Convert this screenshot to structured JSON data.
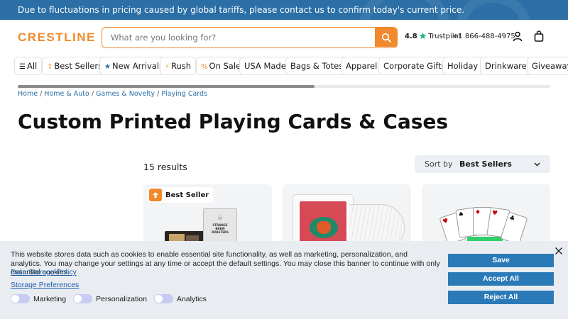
{
  "banner": {
    "text": "Due to fluctuations in pricing caused by global tariffs, please contact us to confirm today's current price."
  },
  "header": {
    "logo": "CRESTLINE",
    "search_placeholder": "What are you looking for?",
    "trustpilot_rating": "4.8",
    "trustpilot_label": "Trustpilot",
    "phone": "+1 866-488-4975"
  },
  "nav": {
    "items": [
      {
        "label": "All",
        "icon": "menu-icon"
      },
      {
        "label": "Best Sellers",
        "icon": "best-seller-icon"
      },
      {
        "label": "New Arrivals",
        "icon": "star-icon"
      },
      {
        "label": "Rush",
        "icon": "rush-icon"
      },
      {
        "label": "On Sale",
        "icon": "percent-icon"
      },
      {
        "label": "USA Made"
      },
      {
        "label": "Bags & Totes"
      },
      {
        "label": "Apparel"
      },
      {
        "label": "Corporate Gifts"
      },
      {
        "label": "Holiday"
      },
      {
        "label": "Drinkware"
      },
      {
        "label": "Giveaways"
      }
    ]
  },
  "breadcrumb": [
    "Home",
    "Home & Auto",
    "Games & Novelty",
    "Playing Cards"
  ],
  "page_title": "Custom Printed Playing Cards & Cases",
  "results": {
    "count_text": "15 results"
  },
  "sort": {
    "label": "Sort by",
    "value": "Best Sellers"
  },
  "products": [
    {
      "badge": "Best Seller",
      "image": "playing-cards-box",
      "box_text": "STRANGE BREW ROASTERS"
    },
    {
      "image": "playing-cards-case"
    },
    {
      "image": "playing-cards-fan"
    }
  ],
  "cookie": {
    "text": "This website stores data such as cookies to enable essential site functionality, as well as marketing, personalization, and analytics. You may change your settings at any time or accept the default settings. You may close this banner to continue with only essential cookies.",
    "data_storage_policy": "Data Storage Policy",
    "storage_preferences": "Storage Preferences",
    "toggles": [
      "Marketing",
      "Personalization",
      "Analytics"
    ],
    "buttons": {
      "save": "Save",
      "accept_all": "Accept All",
      "reject_all": "Reject All"
    }
  },
  "colors": {
    "accent": "#f08a2c",
    "brand_blue": "#2b6fa6",
    "trustpilot_green": "#00b67a"
  }
}
